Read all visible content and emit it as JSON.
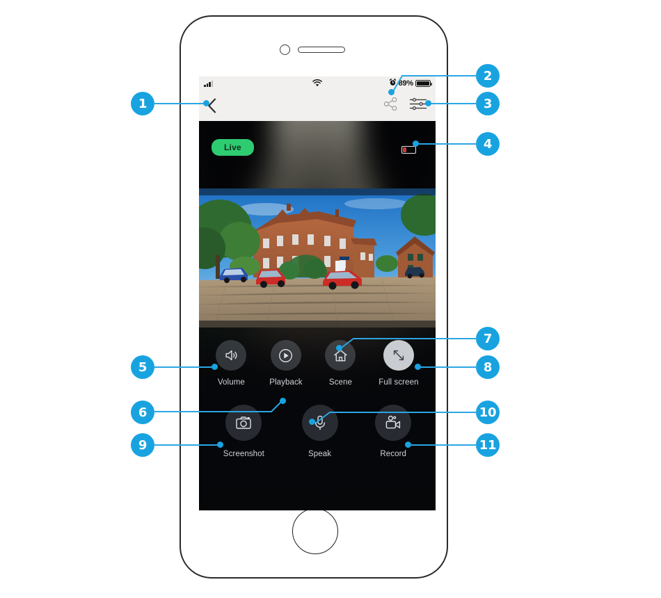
{
  "device": {
    "frame": "smartphone-illustration",
    "home_button": "home-button"
  },
  "status_bar": {
    "signal_icon": "cellular-signal-icon",
    "wifi_icon": "wifi-icon",
    "alarm_icon": "alarm-clock-icon",
    "battery_percent": "89%",
    "battery_icon": "battery-icon"
  },
  "nav_bar": {
    "back_icon": "back-chevron-icon",
    "share_icon": "share-icon",
    "settings_icon": "settings-sliders-icon"
  },
  "video": {
    "live_label": "Live",
    "live_color": "#2ecc71",
    "camera_battery_icon": "camera-battery-icon",
    "camera_battery_level_color": "#d33a35"
  },
  "controls": {
    "primary_row": [
      {
        "label": "Volume",
        "icon": "volume-speaker-icon",
        "active": false
      },
      {
        "label": "Playback",
        "icon": "play-circle-icon",
        "active": false
      },
      {
        "label": "Scene",
        "icon": "home-house-icon",
        "active": false
      },
      {
        "label": "Full screen",
        "icon": "fullscreen-arrows-icon",
        "active": true
      }
    ],
    "secondary_row": [
      {
        "label": "Screenshot",
        "icon": "camera-icon",
        "active": false
      },
      {
        "label": "Speak",
        "icon": "microphone-icon",
        "active": false
      },
      {
        "label": "Record",
        "icon": "video-camera-icon",
        "active": false
      }
    ]
  },
  "callouts": {
    "accent_color": "#18a3e0",
    "items": [
      {
        "number": "1",
        "target": "back-chevron-icon"
      },
      {
        "number": "2",
        "target": "battery-percent-status"
      },
      {
        "number": "3",
        "target": "settings-sliders-icon"
      },
      {
        "number": "4",
        "target": "camera-battery-icon"
      },
      {
        "number": "5",
        "target": "volume-button"
      },
      {
        "number": "6",
        "target": "playback-button"
      },
      {
        "number": "7",
        "target": "scene-button"
      },
      {
        "number": "8",
        "target": "fullscreen-button"
      },
      {
        "number": "9",
        "target": "screenshot-button"
      },
      {
        "number": "10",
        "target": "speak-button"
      },
      {
        "number": "11",
        "target": "record-button"
      }
    ]
  }
}
